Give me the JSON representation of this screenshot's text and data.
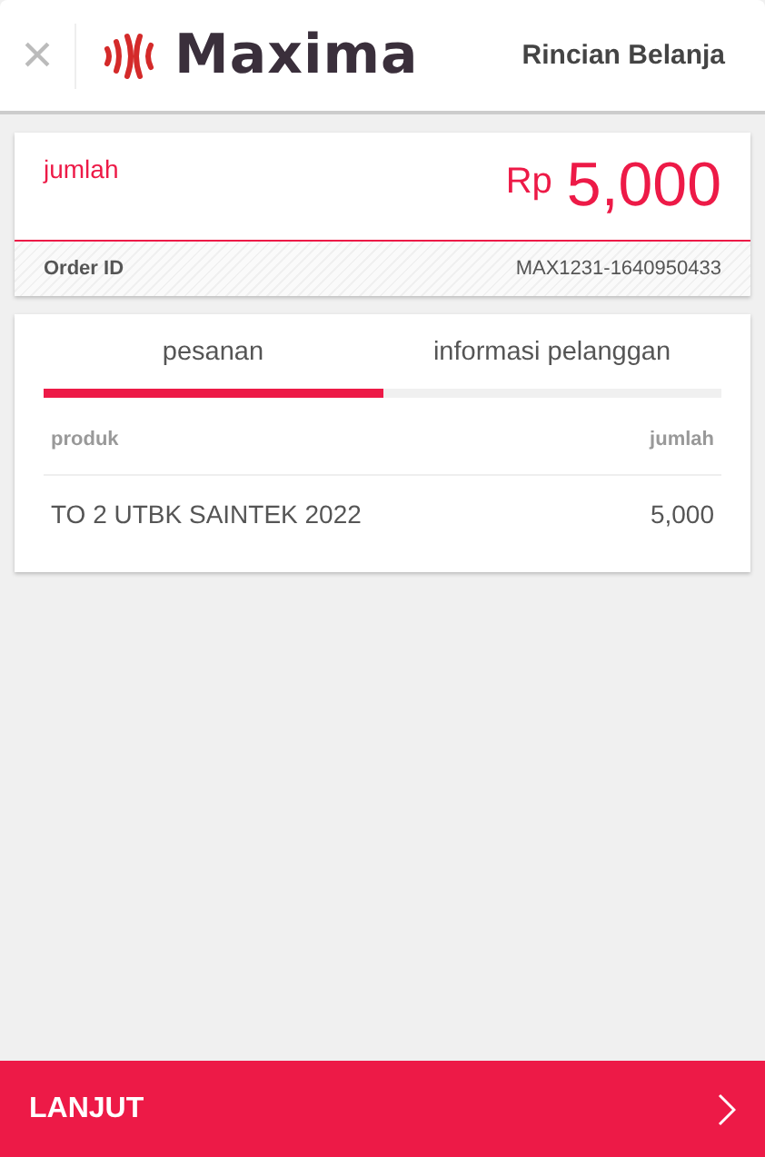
{
  "header": {
    "close": "×",
    "logo": "Maxima",
    "title": "Rincian Belanja"
  },
  "summary": {
    "label": "jumlah",
    "currency": "Rp",
    "amount": "5,000",
    "order_label": "Order ID",
    "order_id": "MAX1231-1640950433"
  },
  "tabs": [
    {
      "label": "pesanan",
      "selected": true
    },
    {
      "label": "informasi pelanggan",
      "selected": false
    }
  ],
  "table": {
    "columns": [
      "produk",
      "jumlah"
    ],
    "rows": [
      [
        "TO 2 UTBK SAINTEK 2022",
        "5,000"
      ]
    ]
  },
  "footer": {
    "button": "LANJUT"
  }
}
